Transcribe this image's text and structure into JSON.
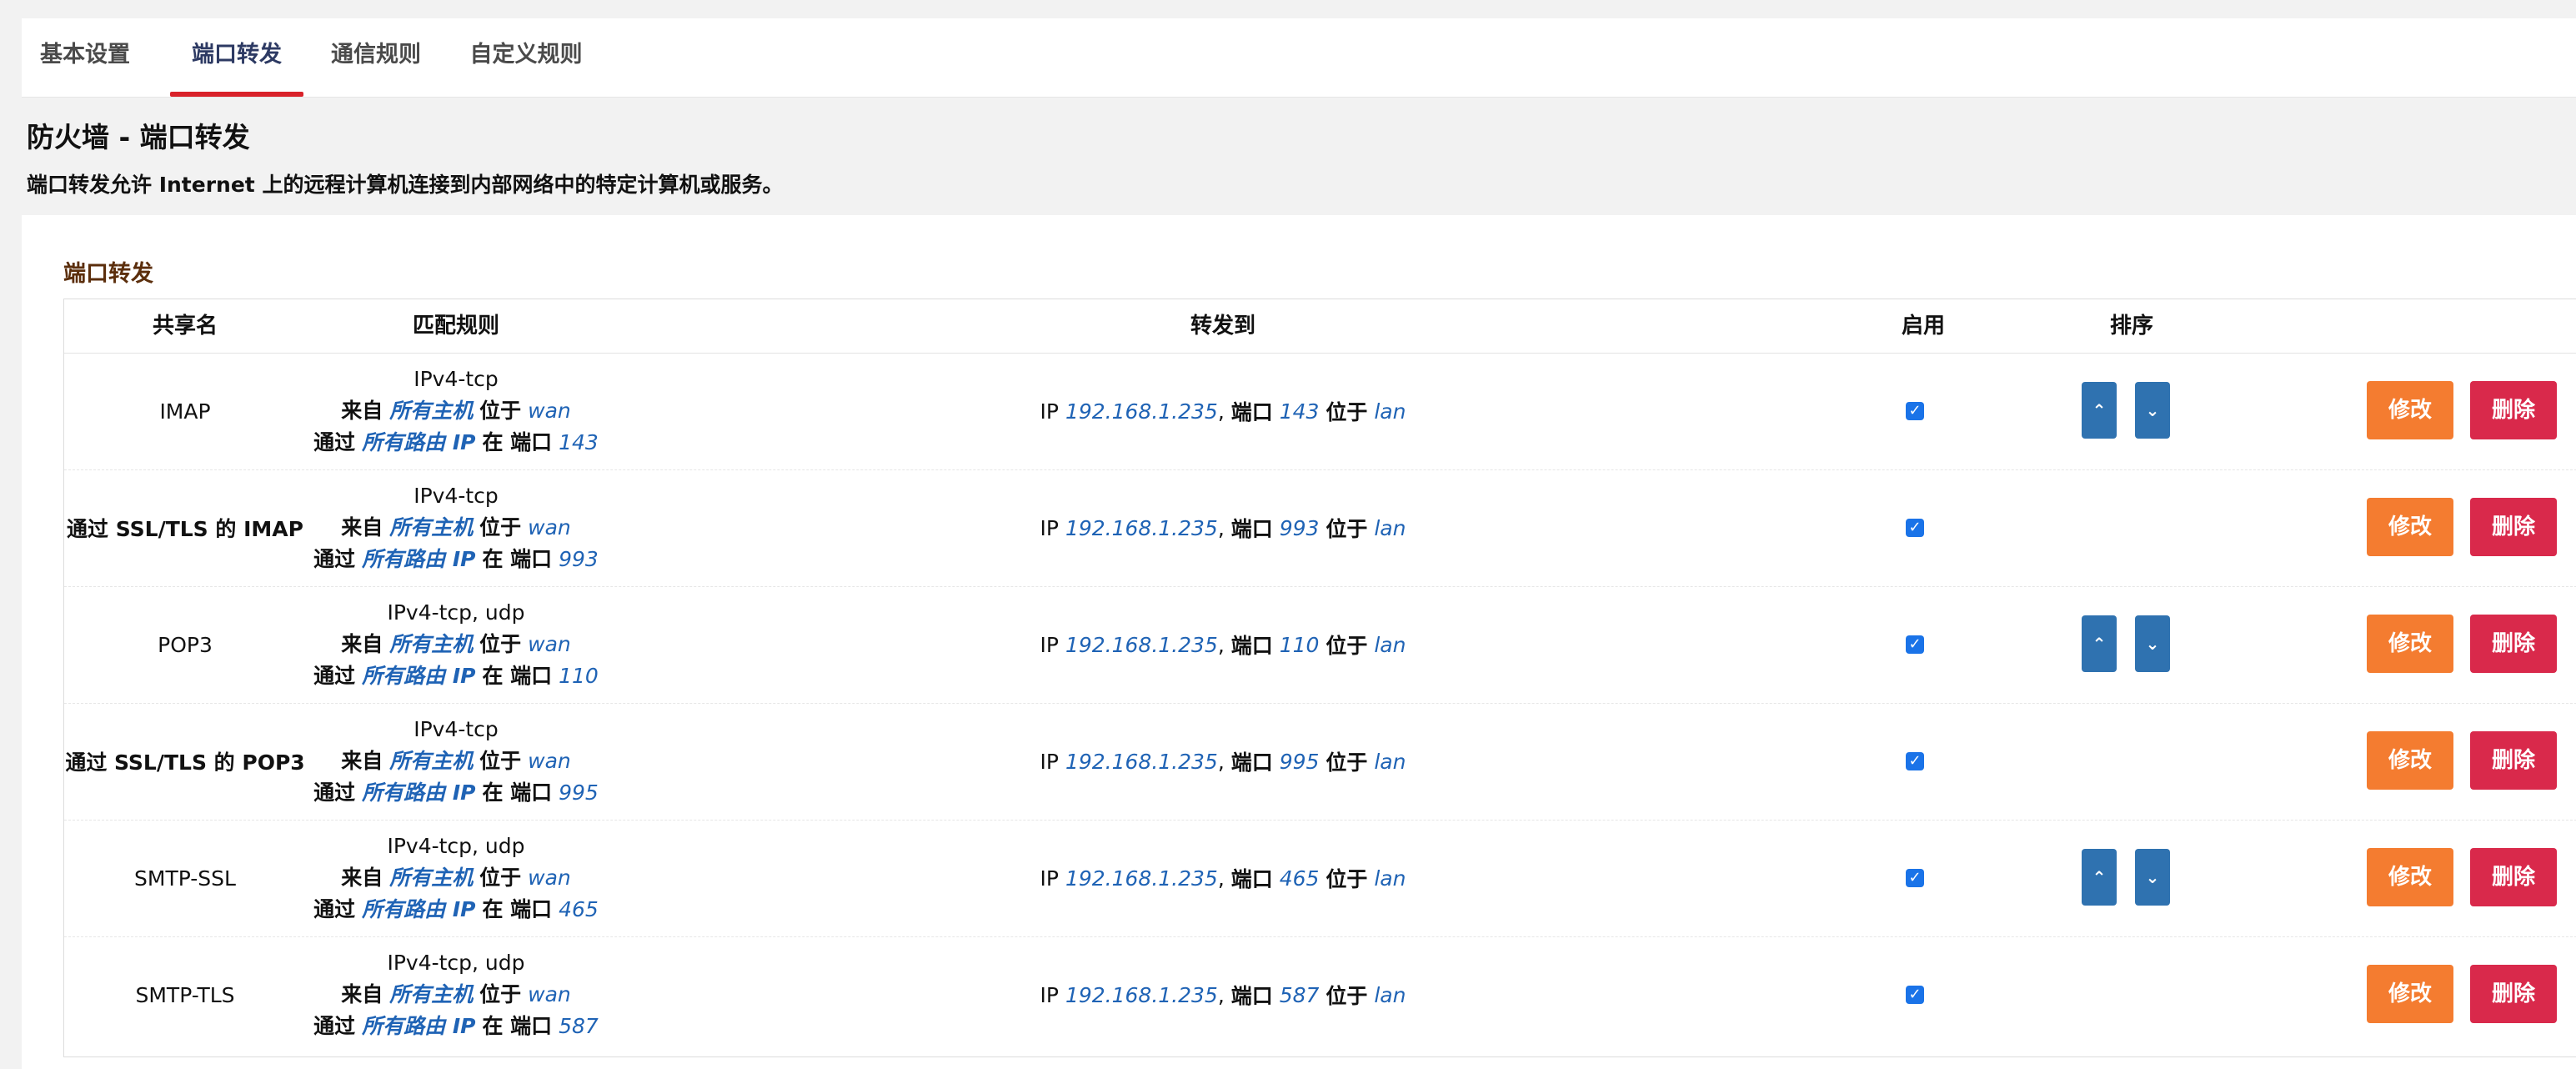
{
  "tabs": [
    {
      "label": "基本设置"
    },
    {
      "label": "端口转发"
    },
    {
      "label": "通信规则"
    },
    {
      "label": "自定义规则"
    }
  ],
  "header": {
    "title": "防火墙 - 端口转发",
    "description": "端口转发允许 Internet 上的远程计算机连接到内部网络中的特定计算机或服务。"
  },
  "section": {
    "title": "端口转发"
  },
  "columns": {
    "name": "共享名",
    "match": "匹配规则",
    "forward": "转发到",
    "enable": "启用",
    "sort": "排序"
  },
  "labels": {
    "from": "来自",
    "any_host": "所有主机",
    "at": "位于",
    "via": "通过",
    "any_router_ip": "所有路由 IP",
    "at_port": "在 端口",
    "ip": "IP",
    "port": "端口",
    "edit": "修改",
    "delete": "删除"
  },
  "rows": [
    {
      "name": "IMAP",
      "proto": "IPv4-tcp",
      "src_zone": "wan",
      "ext_port": "143",
      "dest_ip": "192.168.1.235",
      "dest_port": "143",
      "dest_zone": "lan",
      "enabled": true,
      "sortable": true
    },
    {
      "name": "通过 SSL/TLS 的 IMAP",
      "proto": "IPv4-tcp",
      "src_zone": "wan",
      "ext_port": "993",
      "dest_ip": "192.168.1.235",
      "dest_port": "993",
      "dest_zone": "lan",
      "enabled": true,
      "sortable": false
    },
    {
      "name": "POP3",
      "proto": "IPv4-tcp, udp",
      "src_zone": "wan",
      "ext_port": "110",
      "dest_ip": "192.168.1.235",
      "dest_port": "110",
      "dest_zone": "lan",
      "enabled": true,
      "sortable": true
    },
    {
      "name": "通过 SSL/TLS 的 POP3",
      "proto": "IPv4-tcp",
      "src_zone": "wan",
      "ext_port": "995",
      "dest_ip": "192.168.1.235",
      "dest_port": "995",
      "dest_zone": "lan",
      "enabled": true,
      "sortable": false
    },
    {
      "name": "SMTP-SSL",
      "proto": "IPv4-tcp, udp",
      "src_zone": "wan",
      "ext_port": "465",
      "dest_ip": "192.168.1.235",
      "dest_port": "465",
      "dest_zone": "lan",
      "enabled": true,
      "sortable": true
    },
    {
      "name": "SMTP-TLS",
      "proto": "IPv4-tcp, udp",
      "src_zone": "wan",
      "ext_port": "587",
      "dest_ip": "192.168.1.235",
      "dest_port": "587",
      "dest_zone": "lan",
      "enabled": true,
      "sortable": false
    }
  ],
  "icons": {
    "check": "checkbox-checked-icon",
    "up": "chevron-up-icon",
    "down": "chevron-down-icon"
  },
  "colors": {
    "accent": "#d9222a",
    "link": "#1f63b5",
    "edit": "#f47c30",
    "delete": "#d9294b",
    "sort": "#2f72b0"
  }
}
